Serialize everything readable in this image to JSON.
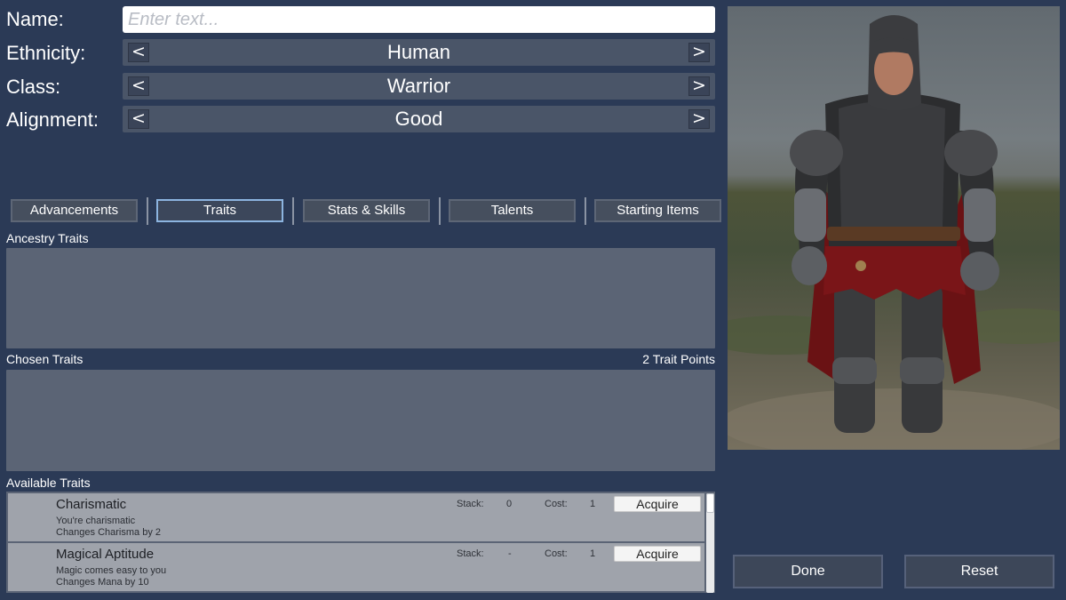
{
  "form": {
    "name": {
      "label": "Name:",
      "placeholder": "Enter text...",
      "value": ""
    },
    "ethnicity": {
      "label": "Ethnicity:",
      "value": "Human"
    },
    "class": {
      "label": "Class:",
      "value": "Warrior"
    },
    "alignment": {
      "label": "Alignment:",
      "value": "Good"
    },
    "prev_glyph": "<",
    "next_glyph": ">"
  },
  "tabs": [
    {
      "label": "Advancements",
      "active": false
    },
    {
      "label": "Traits",
      "active": true
    },
    {
      "label": "Stats & Skills",
      "active": false
    },
    {
      "label": "Talents",
      "active": false
    },
    {
      "label": "Starting Items",
      "active": false
    }
  ],
  "sections": {
    "ancestry": "Ancestry Traits",
    "chosen": "Chosen Traits",
    "trait_points": "2 Trait Points",
    "available": "Available Traits"
  },
  "available_traits": [
    {
      "name": "Charismatic",
      "description": "You're charismatic",
      "effect": "Changes Charisma by 2",
      "stack_label": "Stack:",
      "stack": "0",
      "cost_label": "Cost:",
      "cost": "1",
      "action": "Acquire"
    },
    {
      "name": "Magical Aptitude",
      "description": "Magic comes easy to you",
      "effect": "Changes Mana by 10",
      "stack_label": "Stack:",
      "stack": "-",
      "cost_label": "Cost:",
      "cost": "1",
      "action": "Acquire"
    }
  ],
  "actions": {
    "done": "Done",
    "reset": "Reset"
  },
  "colors": {
    "background": "#2b3a56",
    "panel": "#5b6475",
    "active_tab_border": "#8cb4e0",
    "trait_row": "#9fa3ab"
  },
  "preview": {
    "subject": "armored-warrior-character-model"
  }
}
